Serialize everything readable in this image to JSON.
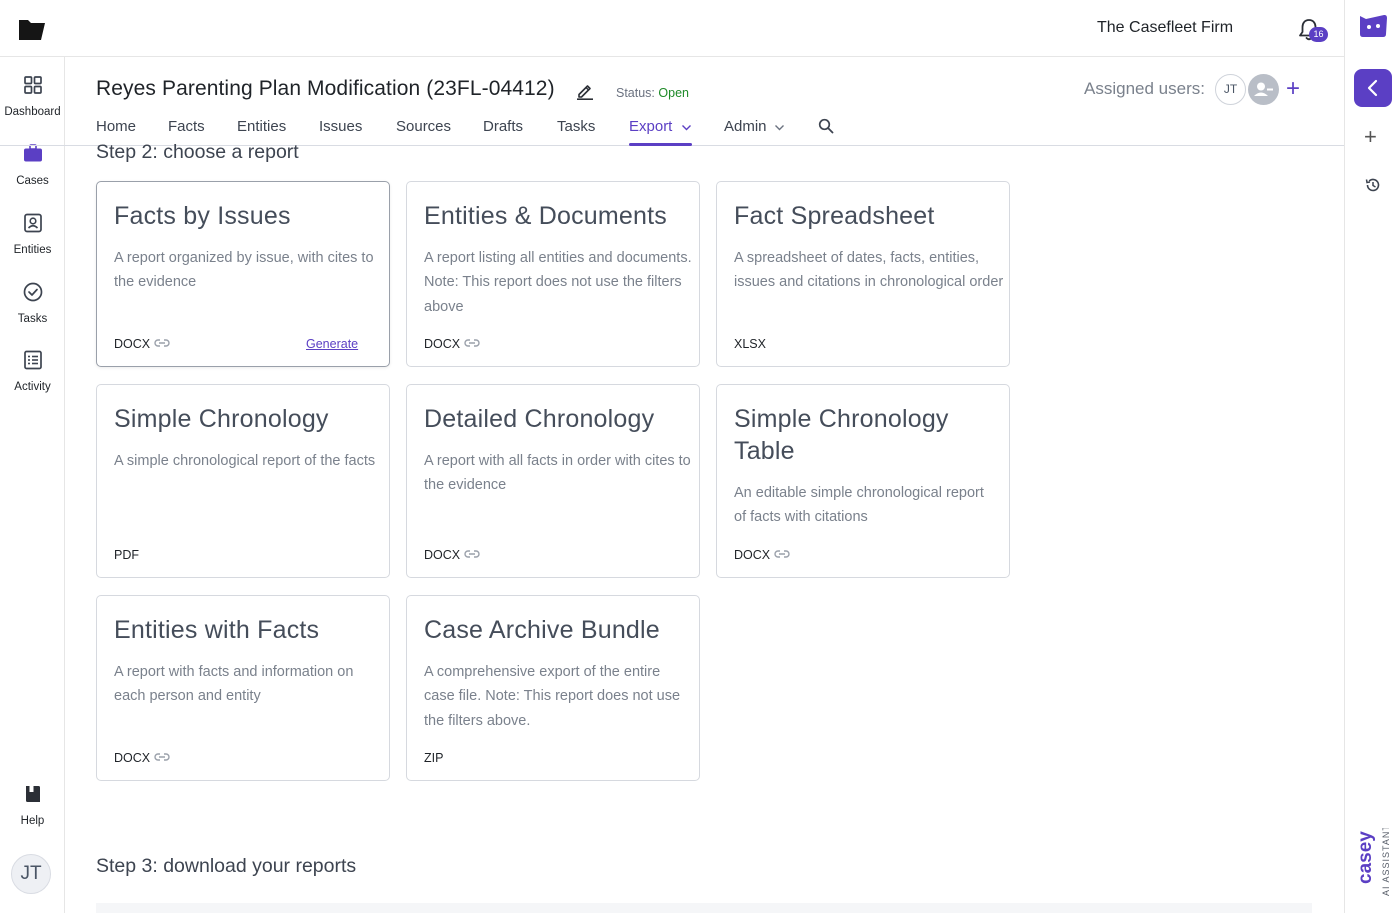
{
  "topbar": {
    "firm_name": "The Casefleet Firm",
    "notification_count": "16"
  },
  "leftnav": {
    "items": [
      {
        "label": "Dashboard",
        "icon": "dashboard-icon"
      },
      {
        "label": "Cases",
        "icon": "briefcase-icon"
      },
      {
        "label": "Entities",
        "icon": "contact-icon"
      },
      {
        "label": "Tasks",
        "icon": "check-circle-icon"
      },
      {
        "label": "Activity",
        "icon": "list-icon"
      }
    ],
    "help_label": "Help",
    "user_initials": "JT"
  },
  "header": {
    "case_title": "Reyes Parenting Plan Modification (23FL-04412)",
    "status_label": "Status:",
    "status_value": "Open",
    "assigned_label": "Assigned users:",
    "assigned_user_initials": "JT"
  },
  "tabs": [
    "Home",
    "Facts",
    "Entities",
    "Issues",
    "Sources",
    "Drafts",
    "Tasks",
    "Export",
    "Admin"
  ],
  "active_tab": "Export",
  "step2_heading": "Step 2: choose a report",
  "step3_heading": "Step 3: download your reports",
  "reports": [
    {
      "title": "Facts by Issues",
      "description": "A report organized by issue, with cites to the evidence",
      "format": "DOCX",
      "linked": true,
      "action": "Generate",
      "selected": true
    },
    {
      "title": "Entities & Documents",
      "description": "A report listing all entities and documents. Note: This report does not use the filters above",
      "format": "DOCX",
      "linked": true
    },
    {
      "title": "Fact Spreadsheet",
      "description": "A spreadsheet of dates, facts, entities, issues and citations in chronological order",
      "format": "XLSX",
      "linked": false
    },
    {
      "title": "Simple Chronology",
      "description": "A simple chronological report of the facts",
      "format": "PDF",
      "linked": false
    },
    {
      "title": "Detailed Chronology",
      "description": "A report with all facts in order with cites to the evidence",
      "format": "DOCX",
      "linked": true
    },
    {
      "title": "Simple Chronology Table",
      "description": "An editable simple chronological report of facts with citations",
      "format": "DOCX",
      "linked": true
    },
    {
      "title": "Entities with Facts",
      "description": "A report with facts and information on each person and entity",
      "format": "DOCX",
      "linked": true
    },
    {
      "title": "Case Archive Bundle",
      "description": "A comprehensive export of the entire case file. Note: This report does not use the filters above.",
      "format": "ZIP",
      "linked": false
    }
  ],
  "casey": {
    "name": "casey",
    "tagline": "AI ASSISTANT"
  },
  "colors": {
    "accent": "#5b3fc4",
    "status_open": "#1e8a28"
  }
}
